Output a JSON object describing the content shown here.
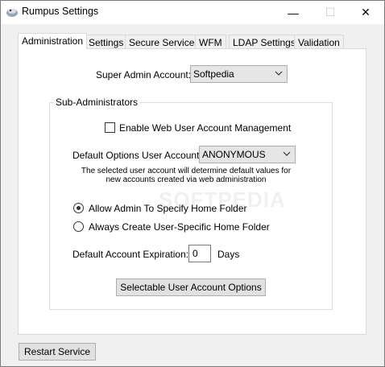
{
  "window": {
    "title": "Rumpus Settings",
    "controls": {
      "minimize": "—",
      "maximize": "☐",
      "close": "✕"
    }
  },
  "tabs": [
    {
      "label": "Administration",
      "active": true
    },
    {
      "label": "Settings"
    },
    {
      "label": "Secure Services"
    },
    {
      "label": "WFM"
    },
    {
      "label": "LDAP Settings"
    },
    {
      "label": "Validation"
    }
  ],
  "admin": {
    "super_admin_label": "Super Admin Account:",
    "super_admin_value": "Softpedia"
  },
  "sub_admins": {
    "group_title": "Sub-Administrators",
    "enable_checkbox_label": "Enable Web User Account Management",
    "enable_checked": false,
    "default_options_label": "Default Options User Account:",
    "default_options_value": "ANONYMOUS",
    "note": "The selected user account will determine default values for new accounts created via web administration",
    "radio_allow": "Allow Admin To Specify Home Folder",
    "radio_always": "Always Create User-Specific Home Folder",
    "selected_radio": "allow",
    "expiration_label": "Default Account Expiration:",
    "expiration_value": "0",
    "expiration_unit": "Days",
    "options_button": "Selectable User Account Options"
  },
  "footer": {
    "restart_button": "Restart Service"
  },
  "watermark": "SOFTPEDIA",
  "icons": [
    "app-icon",
    "chevron-down-icon",
    "minimize-icon",
    "maximize-icon",
    "close-icon"
  ]
}
